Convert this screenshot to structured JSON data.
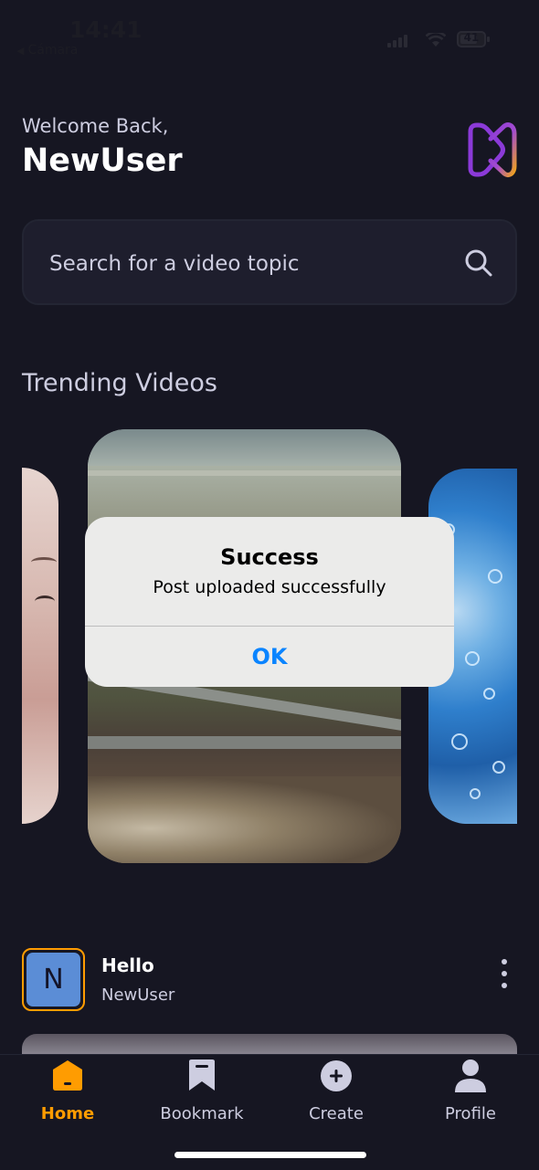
{
  "status_bar": {
    "time": "14:41",
    "back_app": "Cámara",
    "battery": "41"
  },
  "header": {
    "welcome": "Welcome Back,",
    "username": "NewUser",
    "logo_icon": "app-logo-icon"
  },
  "search": {
    "placeholder": "Search for a video topic",
    "value": ""
  },
  "trending": {
    "title": "Trending Videos"
  },
  "alert": {
    "title": "Success",
    "message": "Post uploaded successfully",
    "ok_label": "OK"
  },
  "post": {
    "avatar_letter": "N",
    "title": "Hello",
    "author": "NewUser"
  },
  "tabs": [
    {
      "label": "Home",
      "icon": "home-icon",
      "active": true
    },
    {
      "label": "Bookmark",
      "icon": "bookmark-icon",
      "active": false
    },
    {
      "label": "Create",
      "icon": "plus-icon",
      "active": false
    },
    {
      "label": "Profile",
      "icon": "profile-icon",
      "active": false
    }
  ],
  "colors": {
    "background": "#161622",
    "accent": "#FF9C01",
    "alert_button": "#0A84FF",
    "muted_text": "#CDCDE0"
  }
}
